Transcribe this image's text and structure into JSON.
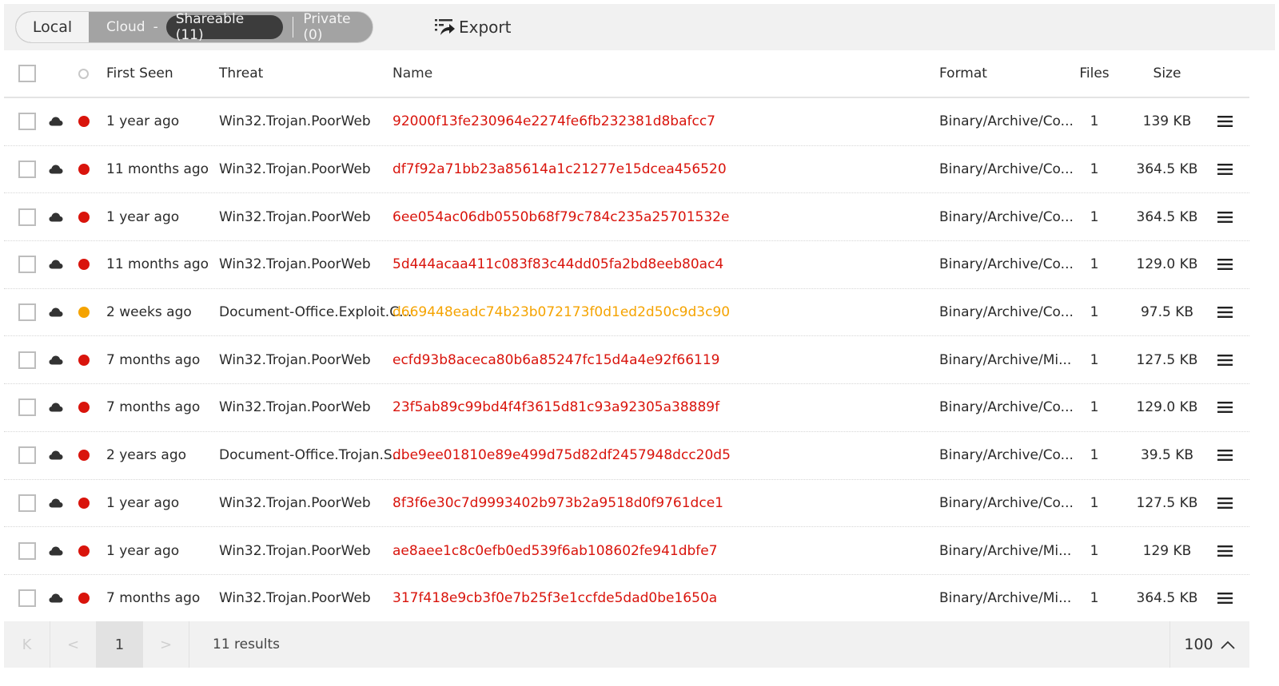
{
  "toolbar": {
    "local_label": "Local",
    "cloud_label": "Cloud",
    "cloud_separator": "-",
    "shareable_label": "Shareable (11)",
    "private_label": "Private (0)",
    "export_label": "Export"
  },
  "table": {
    "columns": {
      "first_seen": "First Seen",
      "threat": "Threat",
      "name": "Name",
      "format": "Format",
      "files": "Files",
      "size": "Size"
    },
    "status_colors": {
      "malicious": "#d9140c",
      "suspicious": "#f5a300"
    },
    "rows": [
      {
        "first_seen": "1 year ago",
        "threat": "Win32.Trojan.PoorWeb",
        "name": "92000f13fe230964e2274fe6fb232381d8bafcc7",
        "format": "Binary/Archive/Co...",
        "files": "1",
        "size": "139 KB",
        "status": "malicious",
        "storage_icon": "cloud-icon"
      },
      {
        "first_seen": "11 months ago",
        "threat": "Win32.Trojan.PoorWeb",
        "name": "df7f92a71bb23a85614a1c21277e15dcea456520",
        "format": "Binary/Archive/Co...",
        "files": "1",
        "size": "364.5 KB",
        "status": "malicious",
        "storage_icon": "cloud-icon"
      },
      {
        "first_seen": "1 year ago",
        "threat": "Win32.Trojan.PoorWeb",
        "name": "6ee054ac06db0550b68f79c784c235a25701532e",
        "format": "Binary/Archive/Co...",
        "files": "1",
        "size": "364.5 KB",
        "status": "malicious",
        "storage_icon": "cloud-icon"
      },
      {
        "first_seen": "11 months ago",
        "threat": "Win32.Trojan.PoorWeb",
        "name": "5d444acaa411c083f83c44dd05fa2bd8eeb80ac4",
        "format": "Binary/Archive/Co...",
        "files": "1",
        "size": "129.0 KB",
        "status": "malicious",
        "storage_icon": "cloud-icon"
      },
      {
        "first_seen": "2 weeks ago",
        "threat": "Document-Office.Exploit.C...",
        "name": "d669448eadc74b23b072173f0d1ed2d50c9d3c90",
        "format": "Binary/Archive/Co...",
        "files": "1",
        "size": "97.5 KB",
        "status": "suspicious",
        "storage_icon": "cloud-icon"
      },
      {
        "first_seen": "7 months ago",
        "threat": "Win32.Trojan.PoorWeb",
        "name": "ecfd93b8aceca80b6a85247fc15d4a4e92f66119",
        "format": "Binary/Archive/Mi...",
        "files": "1",
        "size": "127.5 KB",
        "status": "malicious",
        "storage_icon": "cloud-icon"
      },
      {
        "first_seen": "7 months ago",
        "threat": "Win32.Trojan.PoorWeb",
        "name": "23f5ab89c99bd4f4f3615d81c93a92305a38889f",
        "format": "Binary/Archive/Co...",
        "files": "1",
        "size": "129.0 KB",
        "status": "malicious",
        "storage_icon": "cloud-icon"
      },
      {
        "first_seen": "2 years ago",
        "threat": "Document-Office.Trojan.S...",
        "name": "dbe9ee01810e89e499d75d82df2457948dcc20d5",
        "format": "Binary/Archive/Co...",
        "files": "1",
        "size": "39.5 KB",
        "status": "malicious",
        "storage_icon": "cloud-icon"
      },
      {
        "first_seen": "1 year ago",
        "threat": "Win32.Trojan.PoorWeb",
        "name": "8f3f6e30c7d9993402b973b2a9518d0f9761dce1",
        "format": "Binary/Archive/Co...",
        "files": "1",
        "size": "127.5 KB",
        "status": "malicious",
        "storage_icon": "cloud-icon"
      },
      {
        "first_seen": "1 year ago",
        "threat": "Win32.Trojan.PoorWeb",
        "name": "ae8aee1c8c0efb0ed539f6ab108602fe941dbfe7",
        "format": "Binary/Archive/Mi...",
        "files": "1",
        "size": "129 KB",
        "status": "malicious",
        "storage_icon": "cloud-icon"
      },
      {
        "first_seen": "7 months ago",
        "threat": "Win32.Trojan.PoorWeb",
        "name": "317f418e9cb3f0e7b25f3e1ccfde5dad0be1650a",
        "format": "Binary/Archive/Mi...",
        "files": "1",
        "size": "364.5 KB",
        "status": "malicious",
        "storage_icon": "cloud-icon"
      }
    ]
  },
  "footer": {
    "first_page_glyph": "K",
    "prev_glyph": "<",
    "current_page": "1",
    "next_glyph": ">",
    "results_text": "11 results",
    "per_page": "100"
  }
}
